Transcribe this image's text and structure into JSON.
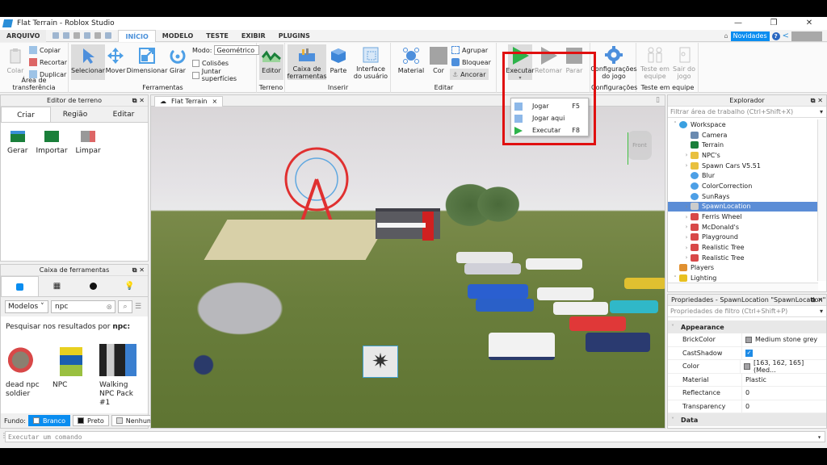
{
  "window": {
    "title": "Flat Terrain - Roblox Studio",
    "minimize": "—",
    "maximize": "❐",
    "close": "✕"
  },
  "menubar": {
    "file": "ARQUIVO",
    "tabs": [
      "INÍCIO",
      "MODELO",
      "TESTE",
      "EXIBIR",
      "PLUGINS"
    ],
    "active_tab": "INÍCIO",
    "whats_new": "Novidades",
    "help": "?"
  },
  "ribbon": {
    "clipboard": {
      "label": "Área de transferência",
      "paste": "Colar",
      "copy": "Copiar",
      "cut": "Recortar",
      "duplicate": "Duplicar"
    },
    "tools": {
      "label": "Ferramentas",
      "select": "Selecionar",
      "move": "Mover",
      "scale": "Dimensionar",
      "rotate": "Girar",
      "mode_label": "Modo:",
      "mode_value": "Geométrico",
      "collisions": "Colisões",
      "join_surfaces": "Juntar superfícies"
    },
    "terrain": {
      "label": "Terreno",
      "editor": "Editor"
    },
    "insert": {
      "label": "Inserir",
      "toolbox": "Caixa de ferramentas",
      "part": "Parte",
      "ui": "Interface do usuário"
    },
    "edit": {
      "label": "Editar",
      "material": "Material",
      "color": "Cor",
      "group": "Agrupar",
      "lock": "Bloquear",
      "anchor": "Ancorar"
    },
    "test": {
      "run": "Executar",
      "resume": "Retomar",
      "stop": "Parar"
    },
    "settings": {
      "label": "Configurações",
      "game_settings": "Configurações do jogo"
    },
    "team_test": {
      "label": "Teste em equipe",
      "team_test": "Teste em equipe",
      "exit_game": "Sair do jogo"
    }
  },
  "run_dropdown": {
    "items": [
      {
        "label": "Jogar",
        "key": "F5"
      },
      {
        "label": "Jogar aqui",
        "key": ""
      },
      {
        "label": "Executar",
        "key": "F8"
      }
    ]
  },
  "terrain_editor": {
    "title": "Editor de terreno",
    "tabs": [
      "Criar",
      "Região",
      "Editar"
    ],
    "active_tab": "Criar",
    "tools": [
      "Gerar",
      "Importar",
      "Limpar"
    ]
  },
  "toolbox": {
    "title": "Caixa de ferramentas",
    "category": "Modelos",
    "search_value": "npc",
    "results_prefix": "Pesquisar nos resultados por",
    "results_term": "npc:",
    "items": [
      "dead npc soldier",
      "NPC",
      "Walking NPC Pack #1"
    ],
    "background_label": "Fundo:",
    "bg_options": [
      "Branco",
      "Preto",
      "Nenhum"
    ],
    "bg_selected": "Branco"
  },
  "viewport": {
    "tab": "Flat Terrain",
    "tab_close": "×",
    "view_cube": "Front"
  },
  "explorer": {
    "title": "Explorador",
    "filter_placeholder": "Filtrar área de trabalho (Ctrl+Shift+X)",
    "items": [
      {
        "label": "Workspace",
        "depth": 0,
        "expander": "open",
        "icon": "globe",
        "selected": false
      },
      {
        "label": "Camera",
        "depth": 1,
        "expander": "none",
        "icon": "camera",
        "selected": false
      },
      {
        "label": "Terrain",
        "depth": 1,
        "expander": "none",
        "icon": "terrain",
        "selected": false
      },
      {
        "label": "NPC's",
        "depth": 1,
        "expander": "closed",
        "icon": "folder",
        "selected": false
      },
      {
        "label": "Spawn Cars V5.51",
        "depth": 1,
        "expander": "closed",
        "icon": "folder",
        "selected": false
      },
      {
        "label": "Blur",
        "depth": 1,
        "expander": "none",
        "icon": "effect",
        "selected": false
      },
      {
        "label": "ColorCorrection",
        "depth": 1,
        "expander": "none",
        "icon": "effect",
        "selected": false
      },
      {
        "label": "SunRays",
        "depth": 1,
        "expander": "none",
        "icon": "effect",
        "selected": false
      },
      {
        "label": "SpawnLocation",
        "depth": 1,
        "expander": "closed",
        "icon": "spawn",
        "selected": true
      },
      {
        "label": "Ferris Wheel",
        "depth": 1,
        "expander": "closed",
        "icon": "model",
        "selected": false
      },
      {
        "label": "McDonald's",
        "depth": 1,
        "expander": "closed",
        "icon": "model",
        "selected": false
      },
      {
        "label": "Playground",
        "depth": 1,
        "expander": "closed",
        "icon": "model",
        "selected": false
      },
      {
        "label": "Realistic Tree",
        "depth": 1,
        "expander": "closed",
        "icon": "model",
        "selected": false
      },
      {
        "label": "Realistic Tree",
        "depth": 1,
        "expander": "closed",
        "icon": "model",
        "selected": false
      },
      {
        "label": "Players",
        "depth": 0,
        "expander": "none",
        "icon": "players",
        "selected": false
      },
      {
        "label": "Lighting",
        "depth": 0,
        "expander": "open",
        "icon": "lighting",
        "selected": false
      }
    ]
  },
  "properties": {
    "title": "Propriedades - SpawnLocation \"SpawnLocation\"",
    "filter_placeholder": "Propriedades de filtro (Ctrl+Shift+P)",
    "sections": [
      {
        "name": "Appearance",
        "rows": [
          {
            "name": "BrickColor",
            "value": "Medium stone grey",
            "swatch": "#a3a2a5"
          },
          {
            "name": "CastShadow",
            "value": "",
            "checked": true
          },
          {
            "name": "Color",
            "value": "[163, 162, 165] (Med...",
            "swatch": "#a3a2a5"
          },
          {
            "name": "Material",
            "value": "Plastic"
          },
          {
            "name": "Reflectance",
            "value": "0"
          },
          {
            "name": "Transparency",
            "value": "0"
          }
        ]
      },
      {
        "name": "Data",
        "rows": []
      }
    ]
  },
  "command_bar": {
    "placeholder": "Executar um comando"
  },
  "colors": {
    "accent": "#0a8df0",
    "selection": "#5b8dd6",
    "highlight_box": "#e01010",
    "play_green": "#2db34a"
  }
}
